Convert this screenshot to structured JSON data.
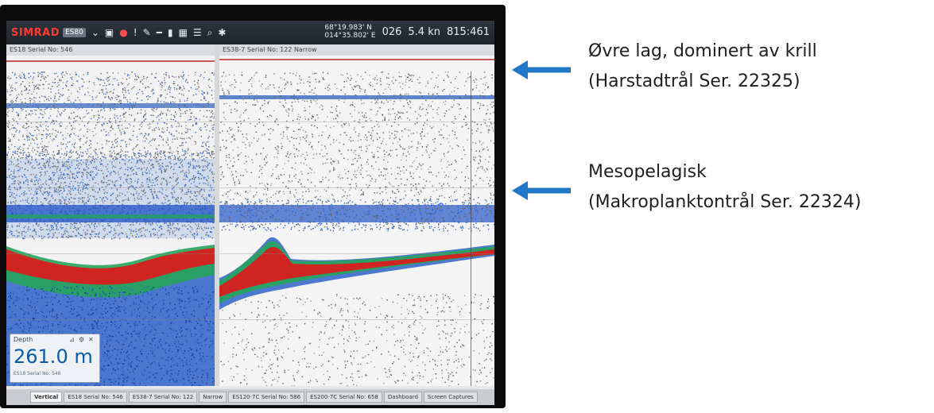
{
  "toolbar": {
    "brand": "SIMRAD",
    "model": "ES80",
    "coord_lat": "68°19.983' N",
    "coord_lon": "014°35.802' E",
    "reading_a": "026",
    "reading_b": "5.4 kn",
    "reading_c": "815:461"
  },
  "panels": {
    "left_title": "ES18 Serial No: 546",
    "right_title": "ES38-7 Serial No: 122   Narrow"
  },
  "depth": {
    "label": "Depth",
    "value": "261.0 m",
    "sub": "ES18 Serial No: 546"
  },
  "statusbar": {
    "tabs": [
      "Vertical",
      "ES18 Serial No: 546",
      "ES38-7 Serial No: 122",
      "Narrow",
      "ES120-7C Serial No: 586",
      "ES200-7C Serial No: 658",
      "Dashboard",
      "Screen Captures"
    ]
  },
  "annotations": {
    "upper": {
      "line1": "Øvre lag, dominert av krill",
      "line2": "(Harstadtrål Ser. 22325)"
    },
    "middle": {
      "line1": "Mesopelagisk",
      "line2": "(Makroplanktontrål Ser. 22324)"
    },
    "arrow_color": "#1f77c8"
  }
}
